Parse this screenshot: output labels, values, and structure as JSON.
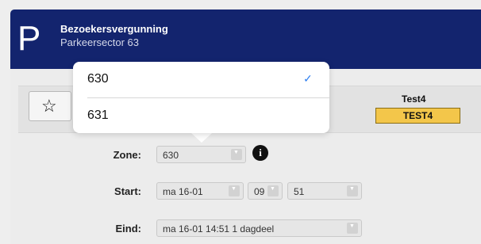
{
  "header": {
    "logo": "P",
    "title": "Bezoekersvergunning",
    "subtitle": "Parkeersector 63"
  },
  "plate": {
    "name": "Test4",
    "badge": "TEST4",
    "badge_color": "#f3c64a"
  },
  "favorite": {
    "icon": "☆",
    "icon_name": "star-icon"
  },
  "dropdown": {
    "items": [
      {
        "label": "630",
        "selected": true
      },
      {
        "label": "631",
        "selected": false
      }
    ],
    "check_icon": "✓"
  },
  "form": {
    "zone_label": "Zone:",
    "zone_value": "630",
    "info_icon": "i",
    "start_label": "Start:",
    "start_day": "ma 16-01",
    "start_hour": "09",
    "start_minute": "51",
    "end_label": "Eind:",
    "end_value": "ma 16-01 14:51 1 dagdeel",
    "select_arrow": "▼"
  },
  "colors": {
    "header_bg": "#13246e",
    "accent_check": "#2f7ff0"
  }
}
